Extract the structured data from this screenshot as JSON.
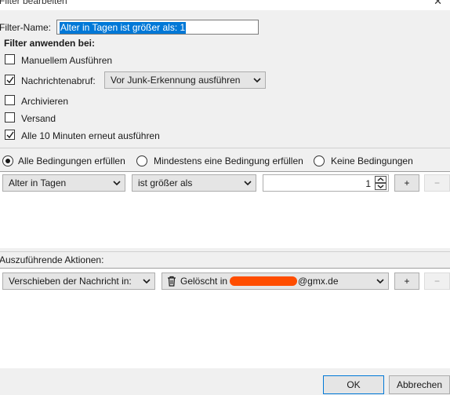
{
  "window": {
    "title": "Filter bearbeiten",
    "close_glyph": "✕"
  },
  "filter_name": {
    "label": "Filter-Name:",
    "value": "Alter in Tagen ist größer als: 1"
  },
  "apply_when": {
    "heading": "Filter anwenden bei:",
    "manual": {
      "label": "Manuellem Ausführen",
      "checked": false
    },
    "on_fetch": {
      "label": "Nachrichtenabruf:",
      "checked": true,
      "selected": "Vor Junk-Erkennung ausführen"
    },
    "archive": {
      "label": "Archivieren",
      "checked": false
    },
    "sending": {
      "label": "Versand",
      "checked": false
    },
    "periodic": {
      "label": "Alle 10 Minuten erneut ausführen",
      "checked": true
    }
  },
  "match": {
    "selected": "all",
    "all": "Alle Bedingungen erfüllen",
    "any": "Mindestens eine Bedingung erfüllen",
    "none": "Keine Bedingungen"
  },
  "condition": {
    "field": "Alter in Tagen",
    "operator": "ist größer als",
    "value": "1",
    "add": "+",
    "remove": "−"
  },
  "actions": {
    "heading": "Auszuführende Aktionen:",
    "action": "Verschieben der Nachricht in:",
    "target_prefix": "Gelöscht in",
    "target_suffix": "@gmx.de",
    "add": "+",
    "remove": "−"
  },
  "footer": {
    "ok": "OK",
    "cancel": "Abbrechen"
  },
  "colors": {
    "selection": "#0078d7",
    "redaction": "#ff4d00"
  },
  "icons": {
    "trash": "trash-icon",
    "chevron": "chevron-down-icon",
    "checkmark": "checkmark-icon"
  }
}
